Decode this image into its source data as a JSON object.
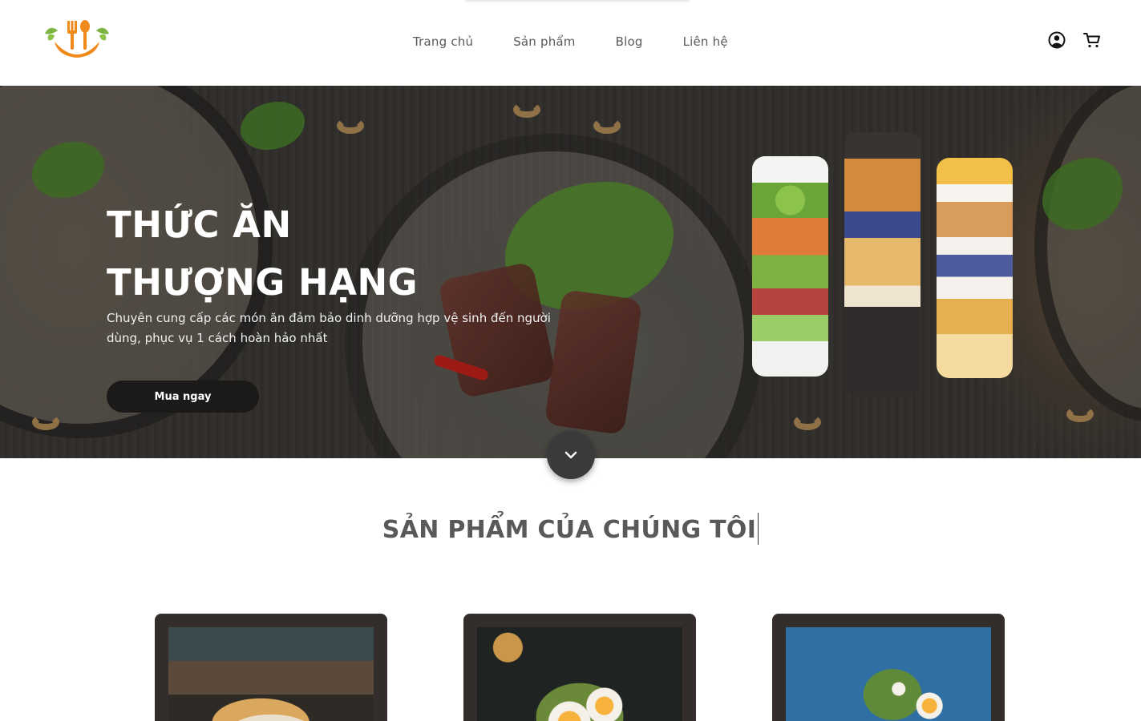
{
  "header": {
    "logo_name": "fork-spoon-logo",
    "nav": [
      {
        "label": "Trang chủ"
      },
      {
        "label": "Sản phẩm"
      },
      {
        "label": "Blog"
      },
      {
        "label": "Liên hệ"
      }
    ],
    "icons": [
      "user-icon",
      "cart-icon"
    ]
  },
  "hero": {
    "title_line1": "THỨC ĂN",
    "title_line2": "THƯỢNG HẠNG",
    "subtitle": "Chuyên cung cấp các món ăn đảm bảo dinh dưỡng hợp vệ sinh đến người dùng, phục vụ 1 cách hoàn hảo nhất",
    "button_label": "Mua ngay",
    "scroll_icon": "chevron-down-icon"
  },
  "products": {
    "section_title": "SẢN PHẨM CỦA CHÚNG TÔI"
  },
  "colors": {
    "accent_orange": "#f08a1c",
    "leaf_green": "#7cb342",
    "dark_button": "#1b1a19",
    "card_bg": "#332e2c",
    "title_gray": "#595959"
  }
}
